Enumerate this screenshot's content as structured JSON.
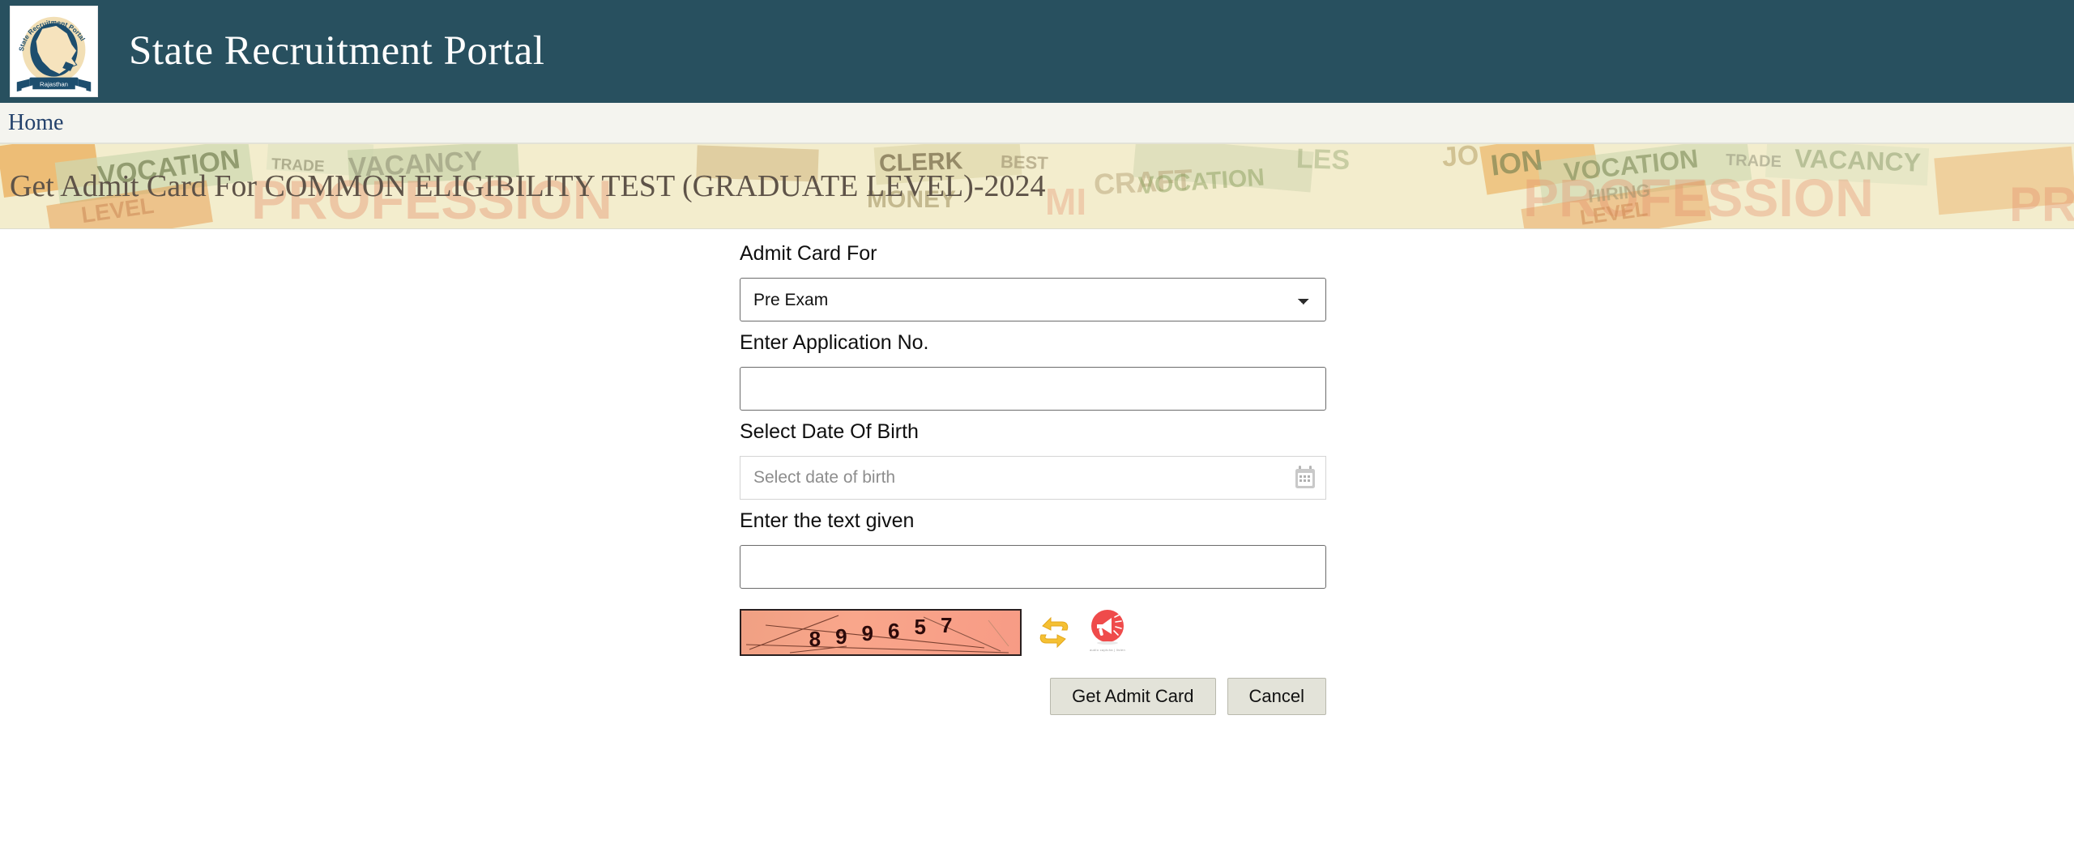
{
  "header": {
    "title": "State Recruitment Portal",
    "logo": {
      "arc_text_left": "State",
      "arc_text_top": "Recruitment",
      "arc_text_right": "Portal",
      "ribbon_text": "Rajasthan"
    },
    "bg_color": "#28505f"
  },
  "nav": {
    "home_label": "Home",
    "bg_color": "#f4f4ef",
    "link_color": "#23416b"
  },
  "banner": {
    "title": "Get Admit Card For COMMON ELIGIBILITY TEST (GRADUATE LEVEL)-2024",
    "text_color": "#5e5348",
    "bg_color": "#f3edcd",
    "collage_words": [
      "VOCATION",
      "TRADE",
      "VACANCY",
      "CLERK",
      "BEST",
      "CRAFT",
      "PROFESSION",
      "MONEY",
      "HIRING",
      "LEVEL",
      "ION",
      "PR",
      "JOBS"
    ]
  },
  "form": {
    "admit_card_for": {
      "label": "Admit Card For",
      "selected": "Pre Exam",
      "options": [
        "Pre Exam"
      ]
    },
    "application_no": {
      "label": "Enter Application No.",
      "value": "",
      "placeholder": ""
    },
    "date_of_birth": {
      "label": "Select Date Of Birth",
      "value": "",
      "placeholder": "Select date of birth",
      "icon": "calendar-icon"
    },
    "captcha_text": {
      "label": "Enter the text given",
      "value": "",
      "placeholder": ""
    },
    "captcha": {
      "digits": [
        "8",
        "9",
        "9",
        "6",
        "5",
        "7"
      ],
      "code": "899657",
      "bg_color": "#f6a286",
      "refresh_icon": "refresh-icon",
      "audio_icon": "audio-speaker-icon",
      "audio_caption": "audio captcha | listen"
    },
    "buttons": {
      "submit_label": "Get Admit Card",
      "cancel_label": "Cancel"
    }
  }
}
